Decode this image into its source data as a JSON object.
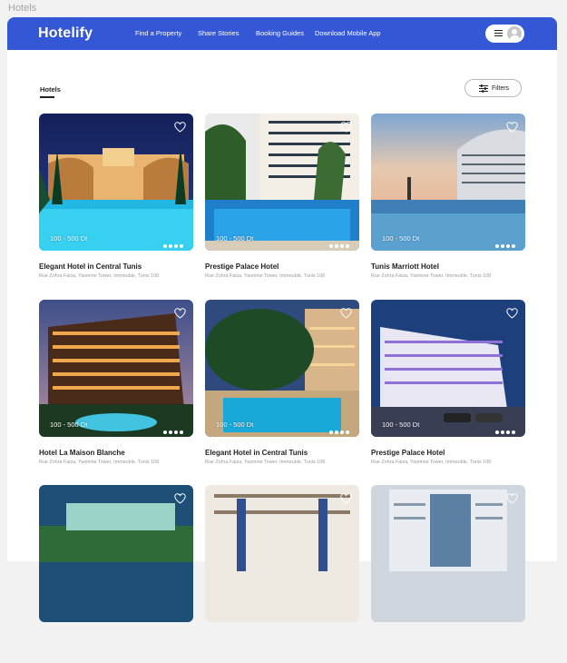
{
  "page_label": "Hotels",
  "brand": {
    "name": "Hotelify",
    "color": "#3457d5"
  },
  "nav": {
    "links": [
      "Find a Property",
      "Share Stories",
      "Booking Guides",
      "Download Mobile App"
    ],
    "menu_icon": "hamburger-icon",
    "avatar_icon": "user-avatar-icon"
  },
  "toolbar": {
    "tab_label": "Hotels",
    "filters_label": "Filters",
    "filters_icon": "sliders-icon"
  },
  "hotels": [
    {
      "name": "Elegant Hotel in Central Tunis",
      "address": "Rue Zohra Faiza, Yasmine Tower, Immeuble, Tunis 108",
      "price": "100 - 500 Dt"
    },
    {
      "name": "Prestige Palace Hotel",
      "address": "Rue Zohra Faiza, Yasmine Tower, Immeuble, Tunis 108",
      "price": "100 - 500 Dt"
    },
    {
      "name": "Tunis Marriott Hotel",
      "address": "Rue Zohra Faiza, Yasmine Tower, Immeuble, Tunis 108",
      "price": "100 - 500 Dt"
    },
    {
      "name": "Hotel La Maison Blanche",
      "address": "Rue Zohra Faiza, Yasmine Tower, Immeuble, Tunis 108",
      "price": "100 - 500 Dt"
    },
    {
      "name": "Elegant Hotel in Central Tunis",
      "address": "Rue Zohra Faiza, Yasmine Tower, Immeuble, Tunis 108",
      "price": "100 - 500 Dt"
    },
    {
      "name": "Prestige Palace Hotel",
      "address": "Rue Zohra Faiza, Yasmine Tower, Immeuble, Tunis 108",
      "price": "100 - 500 Dt"
    },
    {
      "name": "",
      "address": "",
      "price": ""
    },
    {
      "name": "",
      "address": "",
      "price": ""
    },
    {
      "name": "",
      "address": "",
      "price": ""
    }
  ]
}
